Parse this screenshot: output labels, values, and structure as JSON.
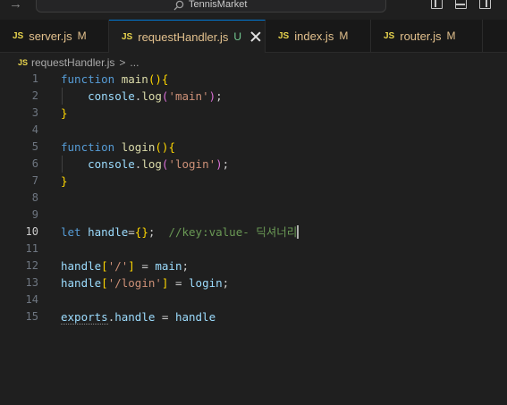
{
  "window": {
    "title": "TennisMarket"
  },
  "tabs": [
    {
      "icon": "JS",
      "name": "server.js",
      "status": "M",
      "active": false
    },
    {
      "icon": "JS",
      "name": "requestHandler.js",
      "status": "U",
      "active": true
    },
    {
      "icon": "JS",
      "name": "index.js",
      "status": "M",
      "active": false
    },
    {
      "icon": "JS",
      "name": "router.js",
      "status": "M",
      "active": false
    }
  ],
  "breadcrumb": {
    "icon": "JS",
    "file": "requestHandler.js",
    "separator": ">",
    "more": "..."
  },
  "editor": {
    "current_line": 10,
    "lines": [
      {
        "n": "1",
        "tokens": [
          [
            "kw",
            "function "
          ],
          [
            "fn",
            "main"
          ],
          [
            "br1",
            "()"
          ],
          [
            "br1",
            "{"
          ]
        ]
      },
      {
        "n": "2",
        "tokens": [
          [
            "pl",
            "    "
          ],
          [
            "var",
            "console"
          ],
          [
            "pl",
            "."
          ],
          [
            "fn",
            "log"
          ],
          [
            "br2",
            "("
          ],
          [
            "str",
            "'main'"
          ],
          [
            "br2",
            ")"
          ],
          [
            "pl",
            ";"
          ]
        ]
      },
      {
        "n": "3",
        "tokens": [
          [
            "br1",
            "}"
          ]
        ]
      },
      {
        "n": "4",
        "tokens": []
      },
      {
        "n": "5",
        "tokens": [
          [
            "kw",
            "function "
          ],
          [
            "fn",
            "login"
          ],
          [
            "br1",
            "()"
          ],
          [
            "br1",
            "{"
          ]
        ]
      },
      {
        "n": "6",
        "tokens": [
          [
            "pl",
            "    "
          ],
          [
            "var",
            "console"
          ],
          [
            "pl",
            "."
          ],
          [
            "fn",
            "log"
          ],
          [
            "br2",
            "("
          ],
          [
            "str",
            "'login'"
          ],
          [
            "br2",
            ")"
          ],
          [
            "pl",
            ";"
          ]
        ]
      },
      {
        "n": "7",
        "tokens": [
          [
            "br1",
            "}"
          ]
        ]
      },
      {
        "n": "8",
        "tokens": []
      },
      {
        "n": "9",
        "tokens": []
      },
      {
        "n": "10",
        "tokens": [
          [
            "kw",
            "let "
          ],
          [
            "var",
            "handle"
          ],
          [
            "pl",
            "="
          ],
          [
            "br1",
            "{}"
          ],
          [
            "pl",
            ";  "
          ],
          [
            "cm",
            "//key:value- 딕셔너리"
          ]
        ]
      },
      {
        "n": "11",
        "tokens": []
      },
      {
        "n": "12",
        "tokens": [
          [
            "var",
            "handle"
          ],
          [
            "br1",
            "["
          ],
          [
            "str",
            "'/'"
          ],
          [
            "br1",
            "]"
          ],
          [
            "pl",
            " = "
          ],
          [
            "var",
            "main"
          ],
          [
            "pl",
            ";"
          ]
        ]
      },
      {
        "n": "13",
        "tokens": [
          [
            "var",
            "handle"
          ],
          [
            "br1",
            "["
          ],
          [
            "str",
            "'/login'"
          ],
          [
            "br1",
            "]"
          ],
          [
            "pl",
            " = "
          ],
          [
            "var",
            "login"
          ],
          [
            "pl",
            ";"
          ]
        ]
      },
      {
        "n": "14",
        "tokens": []
      },
      {
        "n": "15",
        "tokens": [
          [
            "var",
            "exports"
          ],
          [
            "pl",
            "."
          ],
          [
            "var",
            "handle"
          ],
          [
            "pl",
            " = "
          ],
          [
            "var",
            "handle"
          ]
        ]
      }
    ]
  },
  "colors": {
    "keyword": "#569cd6",
    "function": "#dcdcaa",
    "variable": "#9cdcfe",
    "string": "#ce9178",
    "comment": "#6a9955",
    "accent": "#0078d4"
  }
}
